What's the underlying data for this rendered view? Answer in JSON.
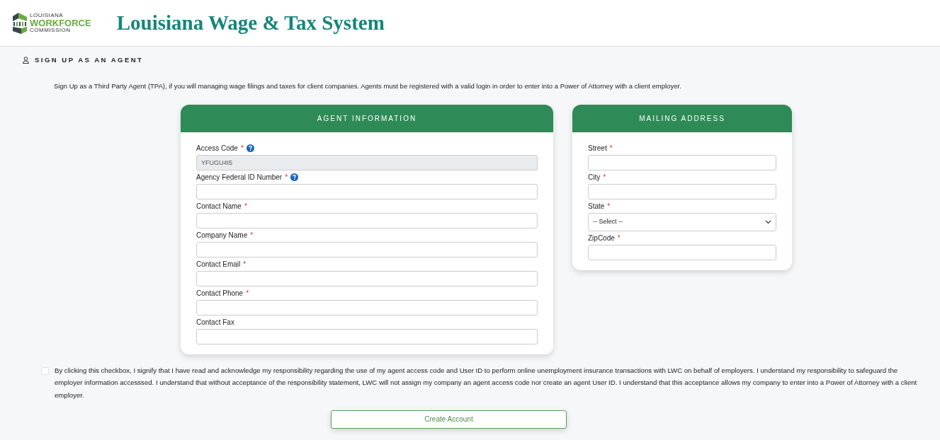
{
  "header": {
    "logo_lines": [
      "LOUISIANA",
      "WORKFORCE",
      "COMMISSION"
    ],
    "title": "Louisiana Wage & Tax System"
  },
  "page_heading": "SIGN UP AS AN AGENT",
  "intro": "Sign Up as a Third Party Agent (TPA), if you will managing wage filings and taxes for client companies. Agents must be registered with a valid login in order to enter into a Power of Attorney with a client employer.",
  "panels": [
    {
      "title": "AGENT INFORMATION",
      "fields": [
        {
          "kind": "text",
          "label": "Access Code",
          "required_mark": "*",
          "help": true,
          "value": "YFUGU4I5",
          "disabled": true
        },
        {
          "kind": "text",
          "label": "Agency Federal ID Number",
          "required_mark": "*",
          "help": true,
          "disabled": false
        },
        {
          "kind": "text",
          "label": "Contact Name",
          "required_mark": "*",
          "disabled": false
        },
        {
          "kind": "text",
          "label": "Company Name",
          "required_mark": "*",
          "disabled": false
        },
        {
          "kind": "text",
          "label": "Contact Email",
          "required_mark": "*",
          "disabled": false
        },
        {
          "kind": "text",
          "label": "Contact Phone",
          "required_mark": "*",
          "disabled": false
        },
        {
          "kind": "text",
          "label": "Contact Fax",
          "disabled": false
        }
      ]
    },
    {
      "title": "MAILING ADDRESS",
      "fields": [
        {
          "kind": "text",
          "label": "Street",
          "required_mark": "*",
          "disabled": false
        },
        {
          "kind": "text",
          "label": "City",
          "required_mark": "*",
          "disabled": false
        },
        {
          "kind": "select",
          "label": "State",
          "required_mark": "*",
          "value": "-- Select --",
          "disabled": false
        },
        {
          "kind": "text",
          "label": "ZipCode",
          "required_mark": "*",
          "disabled": false
        }
      ]
    }
  ],
  "agreement": {
    "checked": false,
    "text": "By clicking this checkbox, I signify that I have read and acknowledge my responsibility regarding the use of my agent access code and User ID to perform online unemployment insurance transactions with LWC on behalf of employers. I understand my responsibility to safeguard the employer information accesssed. I understand that without acceptance of the responsibility statement, LWC will not assign my company an agent access code nor create an agent User ID. I understand that this acceptance allows my company to enter into a Power of Attorney with a client employer."
  },
  "submit_button": "Create Account"
}
